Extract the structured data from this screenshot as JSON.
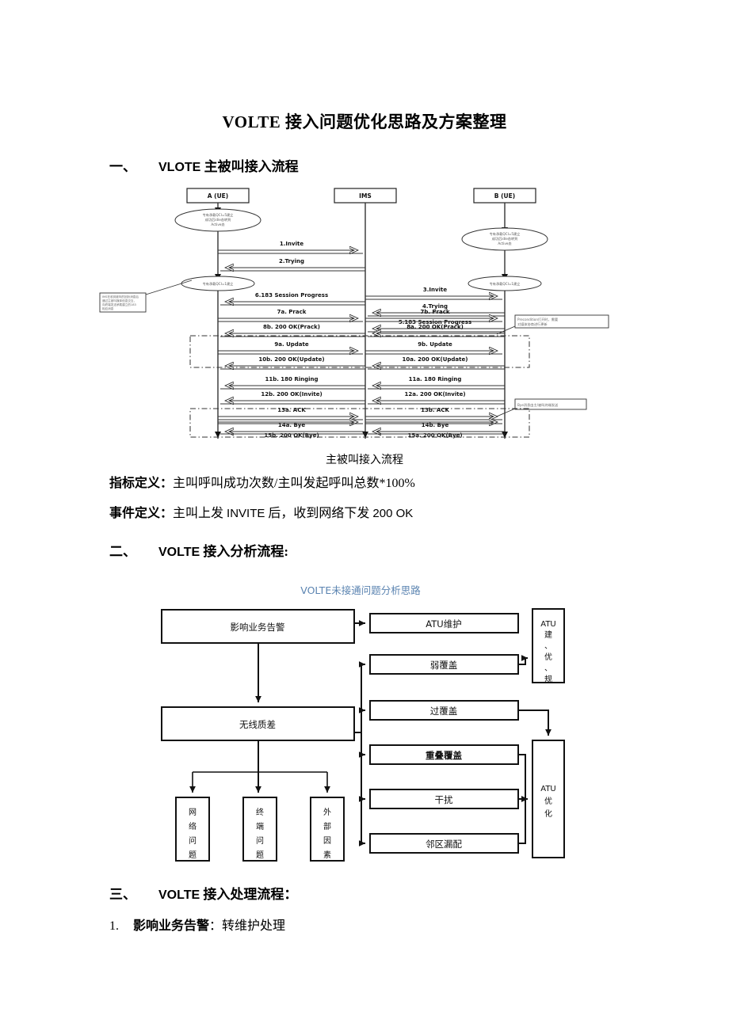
{
  "document": {
    "title": "VOLTE 接入问题优化思路及方案整理"
  },
  "section1": {
    "number": "一、",
    "title_latin": "VLOTE",
    "title_cjk": " 主被叫接入流程",
    "caption": "主被叫接入流程",
    "kpi_label": "指标定义：",
    "kpi_value": "主叫呼叫成功次数/主叫发起呼叫总数*100%",
    "event_label": "事件定义：",
    "event_value_a": "主叫上发 ",
    "event_value_latin1": "INVITE",
    "event_value_b": " 后，收到网络下发 ",
    "event_value_latin2": "200 OK"
  },
  "section2": {
    "number": "二、",
    "title_latin": "VOLTE",
    "title_cjk": " 接入分析流程:"
  },
  "section3": {
    "number": "三、",
    "title_latin": "VOLTE",
    "title_cjk": " 接入处理流程：",
    "items": [
      {
        "index": "1.",
        "label": "影响业务告警",
        "sep": "：",
        "value": "转维护处理"
      }
    ]
  },
  "sequence_diagram": {
    "lifelines": [
      {
        "id": "A",
        "label": "A (UE)"
      },
      {
        "id": "IMS",
        "label": "IMS"
      },
      {
        "id": "B",
        "label": "B (UE)"
      }
    ],
    "ellipse_notes": [
      {
        "id": "a-attach",
        "text": "专有承载QCI=5建立\n成功后idle态转到\nActive态"
      },
      {
        "id": "b-attach",
        "text": "专有承载QCI=5建立\n成功后idle态转到\nActive态"
      },
      {
        "id": "a-qci1",
        "text": "专有承载QCI=1建立"
      },
      {
        "id": "b-qci1",
        "text": "专有承载QCI=1建立"
      }
    ],
    "box_notes": [
      {
        "id": "note-left",
        "text": "IMS在收到被叫的回铃消息后\n通过主被叫媒体信息交互，\n向终端发送承载立的183\n相应消息"
      },
      {
        "id": "note-precondition",
        "text": "Precondition打开时，需要\n对媒体协商进行更新"
      },
      {
        "id": "note-bye",
        "text": "Bye消息由主/被叫终端发送"
      }
    ],
    "messages": [
      {
        "n": 1,
        "label": "1.Invite",
        "from": "A",
        "to": "IMS",
        "dir": "right"
      },
      {
        "n": 2,
        "label": "2.Trying",
        "from": "IMS",
        "to": "A",
        "dir": "left"
      },
      {
        "n": 3,
        "label": "3.Invite",
        "from": "IMS",
        "to": "B",
        "dir": "right"
      },
      {
        "n": 4,
        "label": "4.Trying",
        "from": "B",
        "to": "IMS",
        "dir": "left"
      },
      {
        "n": 5,
        "label": "5.183 Session Progress",
        "from": "B",
        "to": "IMS",
        "dir": "left"
      },
      {
        "n": 6,
        "label": "6.183 Session Progress",
        "from": "IMS",
        "to": "A",
        "dir": "left"
      },
      {
        "n": 7,
        "label": "7a. Prack",
        "from": "A",
        "to": "IMS",
        "dir": "right"
      },
      {
        "n": 7,
        "label": "7b. Prack",
        "from": "IMS",
        "to": "B",
        "dir": "right"
      },
      {
        "n": 8,
        "label": "8b. 200 OK(Prack)",
        "from": "IMS",
        "to": "A",
        "dir": "left"
      },
      {
        "n": 8,
        "label": "8a. 200 OK(Prack)",
        "from": "B",
        "to": "IMS",
        "dir": "left"
      },
      {
        "n": 9,
        "label": "9a. Update",
        "from": "A",
        "to": "IMS",
        "dir": "right"
      },
      {
        "n": 9,
        "label": "9b. Update",
        "from": "IMS",
        "to": "B",
        "dir": "right"
      },
      {
        "n": 10,
        "label": "10b. 200 OK(Update)",
        "from": "IMS",
        "to": "A",
        "dir": "left"
      },
      {
        "n": 10,
        "label": "10a. 200 OK(Update)",
        "from": "B",
        "to": "IMS",
        "dir": "left"
      },
      {
        "n": 11,
        "label": "11b. 180 Ringing",
        "from": "IMS",
        "to": "A",
        "dir": "left"
      },
      {
        "n": 11,
        "label": "11a. 180 Ringing",
        "from": "B",
        "to": "IMS",
        "dir": "left"
      },
      {
        "n": 12,
        "label": "12b. 200 OK(Invite)",
        "from": "IMS",
        "to": "A",
        "dir": "left"
      },
      {
        "n": 12,
        "label": "12a. 200 OK(Invite)",
        "from": "B",
        "to": "IMS",
        "dir": "left"
      },
      {
        "n": 13,
        "label": "13a. ACK",
        "from": "A",
        "to": "IMS",
        "dir": "right"
      },
      {
        "n": 13,
        "label": "13b. ACK",
        "from": "IMS",
        "to": "B",
        "dir": "right"
      },
      {
        "n": 14,
        "label": "14a. Bye",
        "from": "A",
        "to": "IMS",
        "dir": "right"
      },
      {
        "n": 14,
        "label": "14b. Bye",
        "from": "IMS",
        "to": "B",
        "dir": "right"
      },
      {
        "n": 15,
        "label": "15b. 200 OK(Bye)",
        "from": "IMS",
        "to": "A",
        "dir": "left"
      },
      {
        "n": 15,
        "label": "15a. 200 OK(Bye)",
        "from": "B",
        "to": "IMS",
        "dir": "left"
      }
    ]
  },
  "flowchart": {
    "title": "VOLTE未接通问题分析思路",
    "title_color": "#5b84b1",
    "nodes": [
      {
        "id": "alarm",
        "label": "影响业务告警",
        "orient": "h"
      },
      {
        "id": "atu-maint",
        "label": "ATU维护",
        "orient": "h"
      },
      {
        "id": "atu-plan",
        "label": "ATU建、优、规",
        "orient": "v"
      },
      {
        "id": "weak-cov",
        "label": "弱覆盖",
        "orient": "h"
      },
      {
        "id": "over-cov",
        "label": "过覆盖",
        "orient": "h"
      },
      {
        "id": "radio-bad",
        "label": "无线质差",
        "orient": "h"
      },
      {
        "id": "overlap",
        "label": "重叠覆盖",
        "orient": "h",
        "bold": true
      },
      {
        "id": "interf",
        "label": "干扰",
        "orient": "h"
      },
      {
        "id": "nbr-miss",
        "label": "邻区漏配",
        "orient": "h"
      },
      {
        "id": "atu-opt",
        "label": "ATU优化",
        "orient": "v"
      },
      {
        "id": "net-issue",
        "label": "网络问题",
        "orient": "v"
      },
      {
        "id": "ue-issue",
        "label": "终端问题",
        "orient": "v"
      },
      {
        "id": "ext-factor",
        "label": "外部因素",
        "orient": "v"
      }
    ]
  }
}
